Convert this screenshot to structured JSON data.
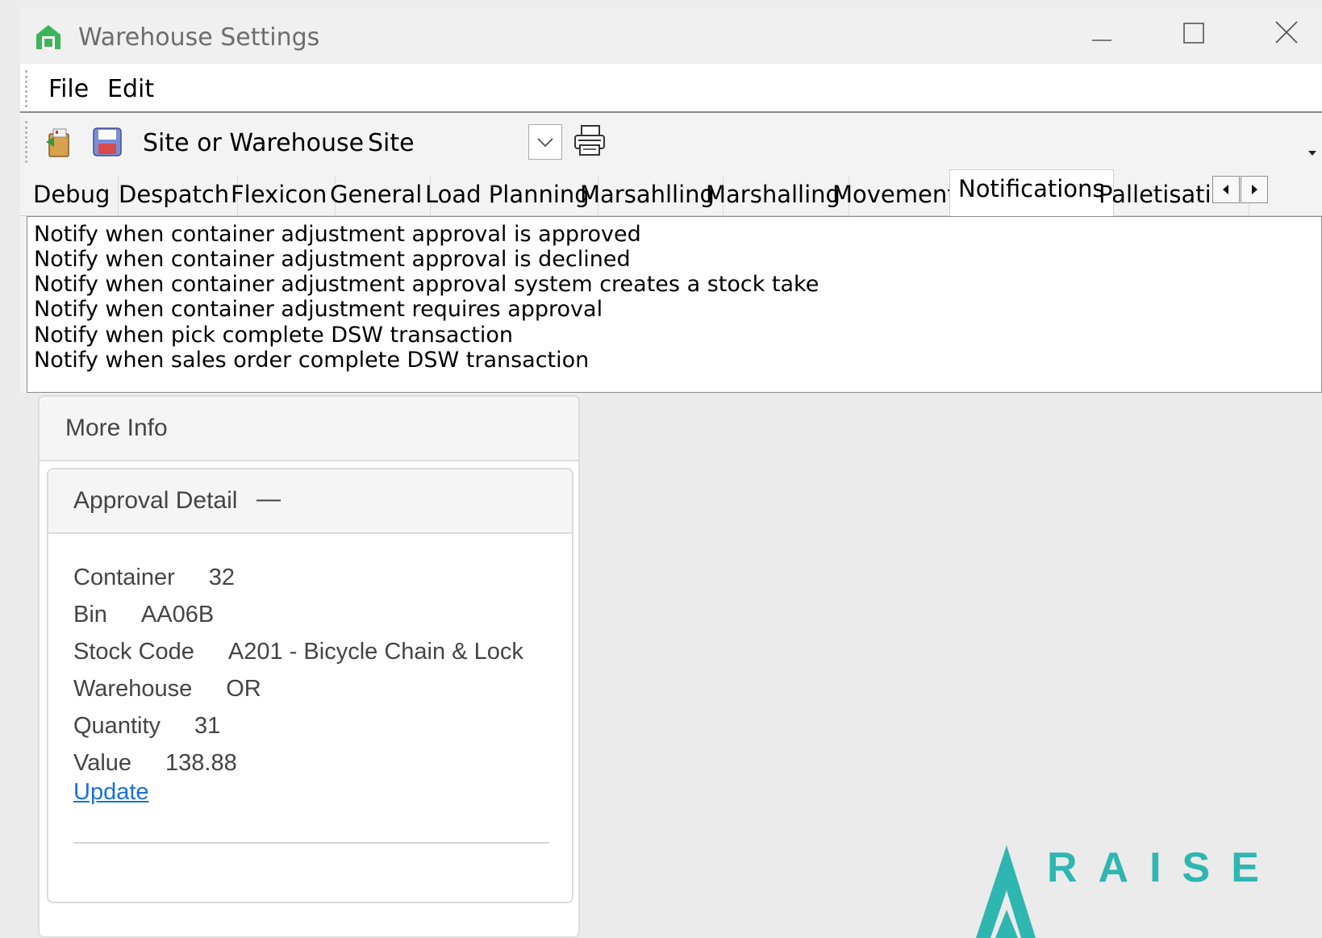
{
  "window": {
    "title": "Warehouse Settings",
    "controls": {
      "minimize": "minimize-icon",
      "maximize": "maximize-icon",
      "close": "close-icon"
    }
  },
  "menu": {
    "file": "File",
    "edit": "Edit"
  },
  "toolbar": {
    "site_label": "Site or Warehouse",
    "site_value": "Site"
  },
  "tabs": [
    "Debug",
    "Despatch",
    "Flexicon",
    "General",
    "Load Planning",
    "Marsahlling",
    "Marshalling",
    "Movements",
    "Notifications",
    "Palletisation"
  ],
  "active_tab": "Notifications",
  "notifications": [
    "Notify when container adjustment approval is approved",
    "Notify when container adjustment approval is declined",
    "Notify when container adjustment approval system creates a stock take",
    "Notify when container adjustment requires approval",
    "Notify when pick complete DSW transaction",
    "Notify when sales order complete DSW transaction"
  ],
  "more_info": {
    "title": "More Info",
    "approval": {
      "title": "Approval Detail",
      "collapse_symbol": "—",
      "fields": [
        {
          "label": "Container",
          "value": "32"
        },
        {
          "label": "Bin",
          "value": "AA06B"
        },
        {
          "label": "Stock Code",
          "value": "A201 - Bicycle Chain & Lock"
        },
        {
          "label": "Warehouse",
          "value": "OR"
        },
        {
          "label": "Quantity",
          "value": "31"
        },
        {
          "label": "Value",
          "value": "138.88"
        }
      ],
      "update_link": "Update"
    }
  },
  "logo": {
    "text": "RAISE",
    "color": "#2fb6b0"
  },
  "colors": {
    "accent_blue": "#1a6fe0",
    "logo_teal": "#2fb6b0"
  }
}
